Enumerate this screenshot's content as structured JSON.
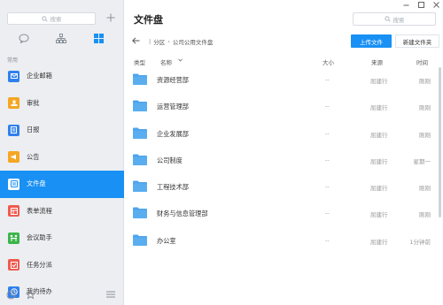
{
  "sidebar": {
    "search_placeholder": "搜索",
    "section_label": "常用",
    "items": [
      {
        "label": "企业邮箱",
        "icon": "mail-icon",
        "color": "#2f80ed"
      },
      {
        "label": "审批",
        "icon": "approval-icon",
        "color": "#f5a623"
      },
      {
        "label": "日报",
        "icon": "report-icon",
        "color": "#2f80ed"
      },
      {
        "label": "公告",
        "icon": "announcement-icon",
        "color": "#f5a623"
      },
      {
        "label": "文件盘",
        "icon": "disk-icon",
        "color": "#1890f4",
        "active": true
      },
      {
        "label": "表单流程",
        "icon": "form-icon",
        "color": "#f05a4f"
      },
      {
        "label": "会议助手",
        "icon": "meeting-icon",
        "color": "#3bb54a"
      },
      {
        "label": "任务分派",
        "icon": "task-icon",
        "color": "#f05a4f"
      },
      {
        "label": "我的待办",
        "icon": "todo-icon",
        "color": "#2f80ed"
      }
    ]
  },
  "main": {
    "title": "文件盘",
    "search_placeholder": "搜索",
    "breadcrumb": [
      "分区",
      "公司公用文件盘"
    ],
    "upload_label": "上传文件",
    "new_folder_label": "新建文件夹",
    "columns": {
      "type": "类型",
      "name": "名称",
      "size": "大小",
      "source": "来源",
      "time": "时间"
    },
    "rows": [
      {
        "name": "资源经营部",
        "size": "--",
        "source": "屈建行",
        "time": "刚刚"
      },
      {
        "name": "运营管理部",
        "size": "--",
        "source": "屈建行",
        "time": "刚刚"
      },
      {
        "name": "企业发展部",
        "size": "--",
        "source": "屈建行",
        "time": "刚刚"
      },
      {
        "name": "公司制度",
        "size": "--",
        "source": "屈建行",
        "time": "星期一"
      },
      {
        "name": "工程技术部",
        "size": "--",
        "source": "屈建行",
        "time": "刚刚"
      },
      {
        "name": "财务与信息管理部",
        "size": "--",
        "source": "屈建行",
        "time": "刚刚"
      },
      {
        "name": "办公室",
        "size": "--",
        "source": "屈建行",
        "time": "1分钟前"
      }
    ]
  },
  "colors": {
    "accent": "#1890f4",
    "folder": "#4ea3ec"
  }
}
